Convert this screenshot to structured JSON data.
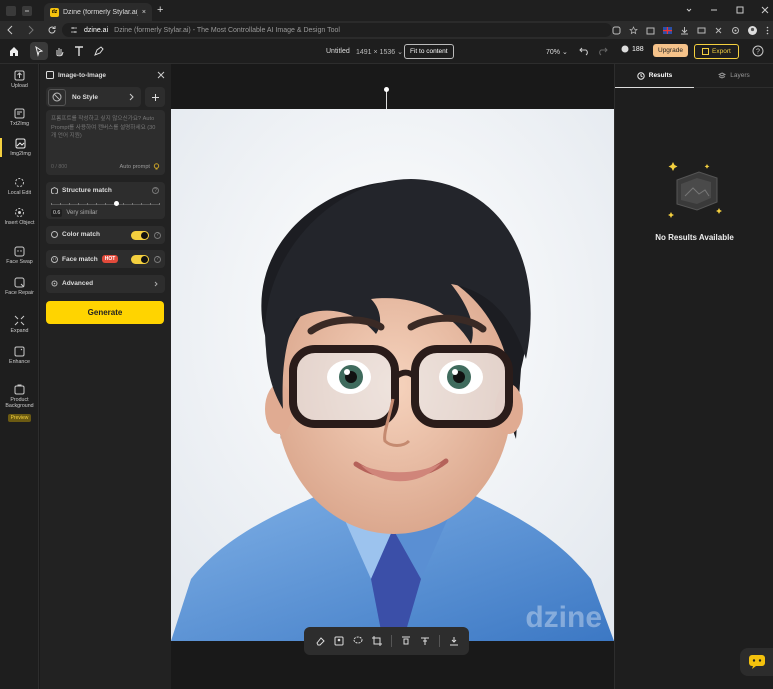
{
  "browser": {
    "tab_title": "Dzine (formerly Stylar.ai) - The",
    "favicon_text": "dz",
    "new_tab": "+",
    "url_domain": "dzine.ai",
    "url_rest": "Dzine (formerly Stylar.ai) - The Most Controllable AI Image & Design Tool"
  },
  "header": {
    "doc_name": "Untitled",
    "dimensions": "1491 × 1536",
    "fit_label": "Fit to content",
    "zoom": "70%",
    "credits": "188",
    "upgrade_label": "Upgrade",
    "export_label": "Export"
  },
  "rail": [
    {
      "label": "Upload",
      "icon": "upload-icon"
    },
    {
      "label": "Txt2Img",
      "icon": "txt2img-icon"
    },
    {
      "label": "Img2Img",
      "icon": "img2img-icon",
      "active": true
    },
    {
      "label": "Local Edit",
      "icon": "local-edit-icon"
    },
    {
      "label": "Insert Object",
      "icon": "insert-object-icon"
    },
    {
      "label": "Face Swap",
      "icon": "face-swap-icon"
    },
    {
      "label": "Face Repair",
      "icon": "face-repair-icon"
    },
    {
      "label": "Expand",
      "icon": "expand-icon"
    },
    {
      "label": "Enhance",
      "icon": "enhance-icon"
    },
    {
      "label": "Product Background",
      "icon": "product-background-icon",
      "badge": "Preview"
    }
  ],
  "panel": {
    "title": "Image-to-Image",
    "style_label": "No Style",
    "prompt_placeholder": "프롬프트를 작성하고 싶지 않으신가요? Auto Prompt를 사용하여 캔버스를 설명하세요 (30개 언어 지원)",
    "char_count": "0 / 800",
    "auto_prompt": "Auto prompt",
    "structure_match": "Structure match",
    "structure_value": "0.6",
    "structure_desc": "Very similar",
    "structure_level": 0.6,
    "color_match": "Color match",
    "color_match_on": true,
    "face_match": "Face match",
    "face_match_badge": "HOT",
    "face_match_on": true,
    "advanced": "Advanced",
    "generate": "Generate"
  },
  "canvas": {
    "watermark": "dzine"
  },
  "right": {
    "tab_results": "Results",
    "tab_layers": "Layers",
    "empty_text": "No Results Available"
  },
  "colors": {
    "accent": "#ffd400",
    "hot": "#e24a3b"
  }
}
